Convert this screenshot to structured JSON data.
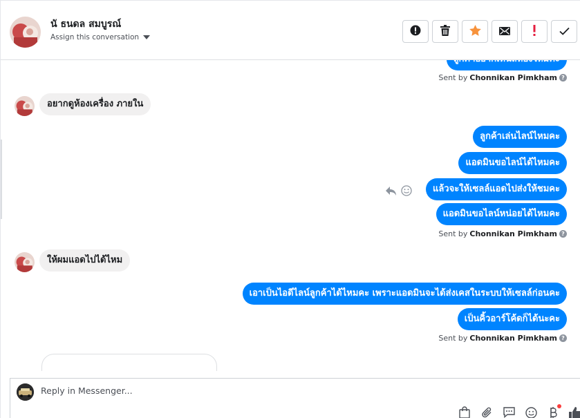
{
  "header": {
    "contact_name": "นั ธนดล สมบูรณ์",
    "assign_label": "Assign this conversation",
    "actions": [
      {
        "name": "report-spam-button",
        "icon": "alert-circle-icon"
      },
      {
        "name": "delete-button",
        "icon": "trash-icon"
      },
      {
        "name": "star-button",
        "icon": "star-icon"
      },
      {
        "name": "mark-unread-button",
        "icon": "envelope-icon"
      },
      {
        "name": "follow-up-button",
        "icon": "exclamation-icon"
      },
      {
        "name": "mark-done-button",
        "icon": "checkmark-icon"
      }
    ]
  },
  "thread": {
    "sender_label": "Sent by",
    "sender_name": "Chonnikan Pimkham",
    "top_partial_message": "ลูกค้าอยากเห็นสีห้องไหมคะ",
    "groups": [
      {
        "type": "incoming",
        "messages": [
          "อยากดูห้องเครื่อง  ภายใน"
        ]
      },
      {
        "type": "outgoing",
        "messages": [
          "ลูกค้าเล่นไลน์ไหมคะ",
          "แอดมินขอไลน์ได้ไหมคะ",
          "แล้วจะให้เซลล์แอดไปส่งให้ชมคะ",
          "แอดมินขอไลน์หน่อยได้ไหมคะ"
        ]
      },
      {
        "type": "incoming",
        "messages": [
          "ให้ผมแอดไปได้ไหม"
        ]
      },
      {
        "type": "outgoing",
        "messages": [
          "เอาเป็นไอดีไลน์ลูกค้าได้ไหมคะ เพราะแอดมินจะได้ส่งเคสในระบบให้เซลล์ก่อนคะ",
          "เป็นคิ้วอาร์โค้ดก็ได้นะคะ"
        ]
      }
    ]
  },
  "composer": {
    "placeholder": "Reply in Messenger...",
    "tools": [
      "shopping-bag-icon",
      "paperclip-icon",
      "saved-replies-icon",
      "emoji-icon",
      "payment-icon",
      "thumbs-up-icon"
    ]
  },
  "colors": {
    "outgoing_bubble": "#0084ff",
    "incoming_bubble": "#f1f0f0",
    "star": "#f7923b",
    "alert": "#e41e3f"
  }
}
